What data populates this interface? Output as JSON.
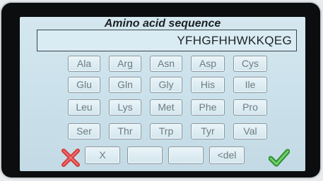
{
  "screen": {
    "title": "Amino acid sequence",
    "sequence_value": "YFHGFHHWKKQEG"
  },
  "keyboard": {
    "rows": [
      [
        "Ala",
        "Arg",
        "Asn",
        "Asp",
        "Cys"
      ],
      [
        "Glu",
        "Gln",
        "Gly",
        "His",
        "Ile"
      ],
      [
        "Leu",
        "Lys",
        "Met",
        "Phe",
        "Pro"
      ],
      [
        "Ser",
        "Thr",
        "Trp",
        "Tyr",
        "Val"
      ]
    ],
    "bottom": {
      "x_label": "X",
      "blank1_label": "",
      "blank2_label": "",
      "delete_label": "<del"
    }
  },
  "icons": {
    "cancel": "close-icon",
    "confirm": "checkmark-icon"
  },
  "colors": {
    "cancel": "#d23a3a",
    "confirm": "#3aa43a",
    "screen_bg": "#cfe3ec"
  }
}
